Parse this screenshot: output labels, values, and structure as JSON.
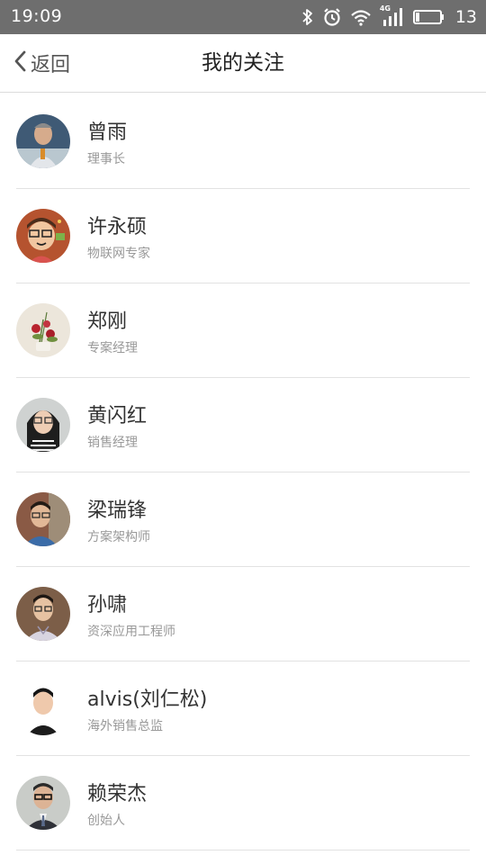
{
  "status_bar": {
    "time": "19:09",
    "network": "4G",
    "battery": "13",
    "icons": [
      "bluetooth-icon",
      "alarm-icon",
      "wifi-icon",
      "signal-icon",
      "battery-icon"
    ]
  },
  "header": {
    "back_label": "返回",
    "title": "我的关注"
  },
  "following": [
    {
      "name": "曾雨",
      "title": "理事长",
      "avatar": "avatar-photo"
    },
    {
      "name": "许永硕",
      "title": "物联网专家",
      "avatar": "avatar-cartoon"
    },
    {
      "name": "郑刚",
      "title": "专案经理",
      "avatar": "avatar-flowers"
    },
    {
      "name": "黄闪红",
      "title": "销售经理",
      "avatar": "avatar-photo"
    },
    {
      "name": "梁瑞锋",
      "title": "方案架构师",
      "avatar": "avatar-photo"
    },
    {
      "name": "孙啸",
      "title": "资深应用工程师",
      "avatar": "avatar-photo"
    },
    {
      "name": "alvis(刘仁松)",
      "title": "海外销售总监",
      "avatar": "avatar-photo"
    },
    {
      "name": "赖荣杰",
      "title": "创始人",
      "avatar": "avatar-photo"
    }
  ],
  "colors": {
    "status_bar_bg": "#6e6e6e",
    "divider": "#e2e2e2",
    "secondary_text": "#999999"
  }
}
